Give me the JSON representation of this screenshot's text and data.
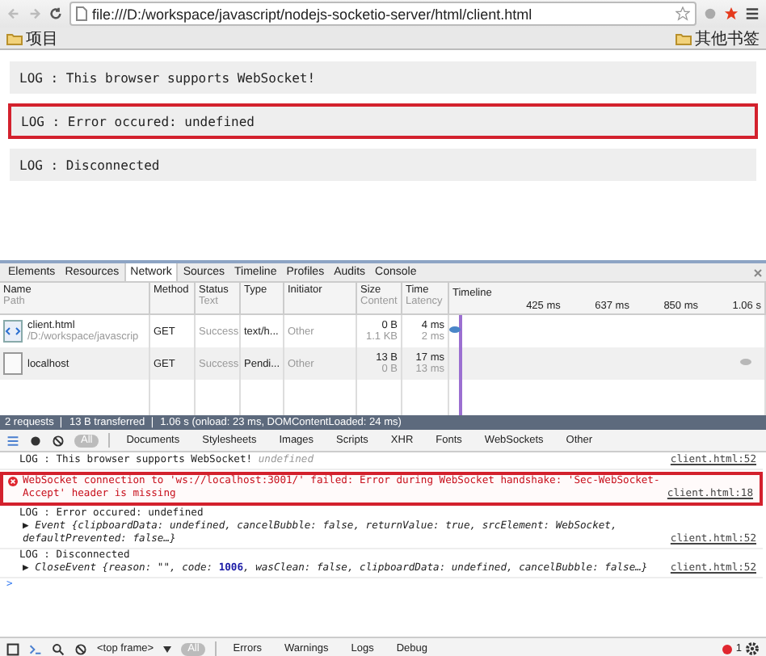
{
  "browser": {
    "url": "file:///D:/workspace/javascript/nodejs-socketio-server/html/client.html",
    "bookmarks": [
      {
        "label": "项目"
      }
    ],
    "other_bookmarks": "其他书签"
  },
  "page": {
    "logs": [
      {
        "text": "LOG : This browser supports WebSocket!",
        "highlighted": false
      },
      {
        "text": "LOG : Error occured: undefined",
        "highlighted": true
      },
      {
        "text": "LOG : Disconnected",
        "highlighted": false
      }
    ]
  },
  "devtools": {
    "tabs": [
      {
        "label": "Elements",
        "selected": false
      },
      {
        "label": "Resources",
        "selected": false
      },
      {
        "label": "Network",
        "selected": true
      },
      {
        "label": "Sources",
        "selected": false
      },
      {
        "label": "Timeline",
        "selected": false
      },
      {
        "label": "Profiles",
        "selected": false
      },
      {
        "label": "Audits",
        "selected": false
      },
      {
        "label": "Console",
        "selected": false
      }
    ],
    "network": {
      "columns": [
        {
          "title": "Name",
          "subtitle": "Path"
        },
        {
          "title": "Method"
        },
        {
          "title": "Status",
          "subtitle": "Text"
        },
        {
          "title": "Type"
        },
        {
          "title": "Initiator"
        },
        {
          "title": "Size",
          "subtitle": "Content"
        },
        {
          "title": "Time",
          "subtitle": "Latency"
        },
        {
          "title": "Timeline"
        }
      ],
      "timeline_ticks": [
        "425 ms",
        "637 ms",
        "850 ms",
        "1.06 s"
      ],
      "rows": [
        {
          "kind": "html",
          "name": "client.html",
          "path": "/D:/workspace/javascrip",
          "method": "GET",
          "status": "Success",
          "type": "text/h...",
          "initiator": "Other",
          "size": "0 B",
          "content": "1.1 KB",
          "time": "4 ms",
          "latency": "2 ms",
          "color": "#4a86c8",
          "level": 0
        },
        {
          "kind": "blank",
          "name": "localhost",
          "method": "GET",
          "status": "Success",
          "type": "Pendi...",
          "initiator": "Other",
          "size": "13 B",
          "content": "0 B",
          "time": "17 ms",
          "latency": "13 ms",
          "color": "#b8b8b8",
          "level": 0.96
        }
      ],
      "summary": "2 requests ❘ 13 B transferred ❘ 1.06 s (onload: 23 ms, DOMContentLoaded: 24 ms)"
    },
    "filters": [
      {
        "label": "All",
        "selected": true
      },
      {
        "label": "Documents",
        "selected": false
      },
      {
        "label": "Stylesheets",
        "selected": false
      },
      {
        "label": "Images",
        "selected": false
      },
      {
        "label": "Scripts",
        "selected": false
      },
      {
        "label": "XHR",
        "selected": false
      },
      {
        "label": "Fonts",
        "selected": false
      },
      {
        "label": "WebSockets",
        "selected": false
      },
      {
        "label": "Other",
        "selected": false
      }
    ],
    "console": [
      {
        "kind": "log",
        "text": "LOG : This browser supports WebSocket!",
        "suffix": "undefined",
        "source": "client.html:52",
        "highlighted": false
      },
      {
        "kind": "error",
        "text": "WebSocket connection to 'ws://localhost:3001/' failed: Error during WebSocket handshake: 'Sec-WebSocket-Accept' header is missing",
        "source": "client.html:18",
        "highlighted": true
      },
      {
        "kind": "log",
        "text": "LOG : Error occured: undefined",
        "object": "▶ Event {clipboardData: undefined, cancelBubble: false, returnValue: true, srcElement: WebSocket, defaultPrevented: false…}",
        "source": "client.html:52",
        "highlighted": false
      },
      {
        "kind": "log",
        "text": "LOG : Disconnected",
        "object": "▶ CloseEvent {reason: \"\", code: **1006**, wasClean: false, clipboardData: undefined, cancelBubble: false…}",
        "source": "client.html:52",
        "highlighted": false
      }
    ],
    "prompt": ">",
    "bottom": {
      "frame": "<top frame>",
      "levels": [
        {
          "label": "All",
          "selected": true
        },
        {
          "label": "Errors",
          "selected": false
        },
        {
          "label": "Warnings",
          "selected": false
        },
        {
          "label": "Logs",
          "selected": false
        },
        {
          "label": "Debug",
          "selected": false
        }
      ],
      "error_count": "1"
    }
  }
}
